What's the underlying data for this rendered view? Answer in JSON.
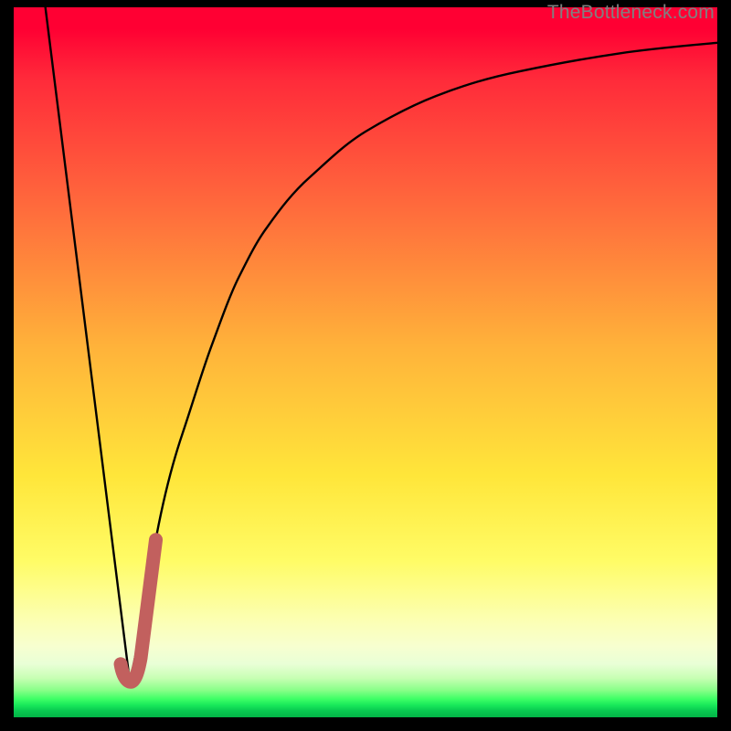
{
  "attribution": "TheBottleneck.com",
  "colors": {
    "page_bg": "#000000",
    "gradient_top": "#ff0033",
    "gradient_mid_orange": "#ff8a3a",
    "gradient_mid_yellow": "#ffe63a",
    "gradient_pale": "#fcffb0",
    "gradient_green": "#03b347",
    "curve_stroke": "#000000",
    "accent_stub": "#c2605e",
    "attribution_text": "#808080"
  },
  "chart_data": {
    "type": "line",
    "title": "",
    "xlabel": "",
    "ylabel": "",
    "xlim": [
      0,
      100
    ],
    "ylim": [
      0,
      100
    ],
    "series": [
      {
        "name": "left-slope",
        "x": [
          4.5,
          16.5
        ],
        "y": [
          100,
          5
        ]
      },
      {
        "name": "right-curve",
        "x": [
          16.5,
          20,
          24,
          28,
          32,
          36,
          42,
          50,
          60,
          72,
          86,
          100
        ],
        "y": [
          5,
          24,
          40,
          52,
          62,
          69,
          76,
          82.5,
          87.5,
          91,
          93.5,
          95
        ]
      },
      {
        "name": "accent-j-stub",
        "x": [
          15.2,
          16.5,
          20.2
        ],
        "y": [
          7.5,
          5,
          25
        ]
      }
    ],
    "annotations": [
      {
        "text": "TheBottleneck.com",
        "position": "top-right"
      }
    ]
  }
}
